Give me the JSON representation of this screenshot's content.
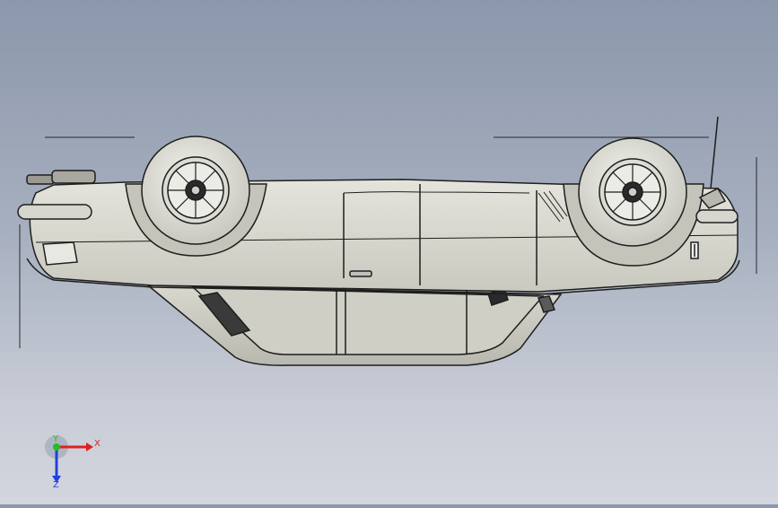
{
  "viewport": {
    "background_top": "#8b97ab",
    "background_bottom": "#d3d6de",
    "model_fill": "#dcdcd3",
    "model_edge": "#1e1e1e"
  },
  "triad": {
    "x_label": "X",
    "y_label": "Y",
    "z_label": "Z",
    "x_color": "#e02020",
    "y_color": "#20c020",
    "z_color": "#2040e0"
  }
}
